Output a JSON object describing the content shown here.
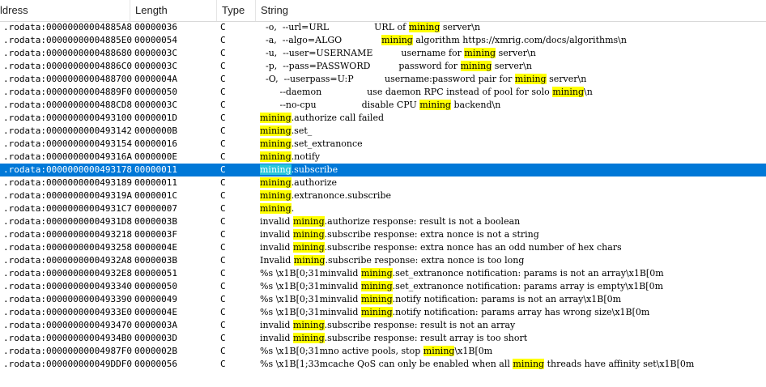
{
  "columns": {
    "address": "ldress",
    "length": "Length",
    "type": "Type",
    "string": "String"
  },
  "highlight_term": "mining",
  "selected_index": 11,
  "rows": [
    {
      "address": ".rodata:00000000004885A8",
      "length": "00000036",
      "type": "C",
      "string": "  -o,  --url=URL                URL of mining server\\n"
    },
    {
      "address": ".rodata:00000000004885E0",
      "length": "00000054",
      "type": "C",
      "string": "  -a,  --algo=ALGO              mining algorithm https://xmrig.com/docs/algorithms\\n"
    },
    {
      "address": ".rodata:0000000000488680",
      "length": "0000003C",
      "type": "C",
      "string": "  -u,  --user=USERNAME          username for mining server\\n"
    },
    {
      "address": ".rodata:00000000004886C0",
      "length": "0000003C",
      "type": "C",
      "string": "  -p,  --pass=PASSWORD          password for mining server\\n"
    },
    {
      "address": ".rodata:0000000000488700",
      "length": "0000004A",
      "type": "C",
      "string": "  -O,  --userpass=U:P           username:password pair for mining server\\n"
    },
    {
      "address": ".rodata:00000000004889F0",
      "length": "00000050",
      "type": "C",
      "string": "       --daemon                use daemon RPC instead of pool for solo mining\\n"
    },
    {
      "address": ".rodata:0000000000488CD8",
      "length": "0000003C",
      "type": "C",
      "string": "       --no-cpu                disable CPU mining backend\\n"
    },
    {
      "address": ".rodata:0000000000493100",
      "length": "0000001D",
      "type": "C",
      "string": "mining.authorize call failed"
    },
    {
      "address": ".rodata:0000000000493142",
      "length": "0000000B",
      "type": "C",
      "string": "mining.set_"
    },
    {
      "address": ".rodata:0000000000493154",
      "length": "00000016",
      "type": "C",
      "string": "mining.set_extranonce"
    },
    {
      "address": ".rodata:000000000049316A",
      "length": "0000000E",
      "type": "C",
      "string": "mining.notify"
    },
    {
      "address": ".rodata:0000000000493178",
      "length": "00000011",
      "type": "C",
      "string": "mining.subscribe"
    },
    {
      "address": ".rodata:0000000000493189",
      "length": "00000011",
      "type": "C",
      "string": "mining.authorize"
    },
    {
      "address": ".rodata:000000000049319A",
      "length": "0000001C",
      "type": "C",
      "string": "mining.extranonce.subscribe"
    },
    {
      "address": ".rodata:00000000004931C7",
      "length": "00000007",
      "type": "C",
      "string": "mining."
    },
    {
      "address": ".rodata:00000000004931D8",
      "length": "0000003B",
      "type": "C",
      "string": "invalid mining.authorize response: result is not a boolean"
    },
    {
      "address": ".rodata:0000000000493218",
      "length": "0000003F",
      "type": "C",
      "string": "invalid mining.subscribe response: extra nonce is not a string"
    },
    {
      "address": ".rodata:0000000000493258",
      "length": "0000004E",
      "type": "C",
      "string": "invalid mining.subscribe response: extra nonce has an odd number of hex chars"
    },
    {
      "address": ".rodata:00000000004932A8",
      "length": "0000003B",
      "type": "C",
      "string": "Invalid mining.subscribe response: extra nonce is too long"
    },
    {
      "address": ".rodata:00000000004932E8",
      "length": "00000051",
      "type": "C",
      "string": "%s \\x1B[0;31minvalid mining.set_extranonce notification: params is not an array\\x1B[0m"
    },
    {
      "address": ".rodata:0000000000493340",
      "length": "00000050",
      "type": "C",
      "string": "%s \\x1B[0;31minvalid mining.set_extranonce notification: params array is empty\\x1B[0m"
    },
    {
      "address": ".rodata:0000000000493390",
      "length": "00000049",
      "type": "C",
      "string": "%s \\x1B[0;31minvalid mining.notify notification: params is not an array\\x1B[0m"
    },
    {
      "address": ".rodata:00000000004933E0",
      "length": "0000004E",
      "type": "C",
      "string": "%s \\x1B[0;31minvalid mining.notify notification: params array has wrong size\\x1B[0m"
    },
    {
      "address": ".rodata:0000000000493470",
      "length": "0000003A",
      "type": "C",
      "string": "invalid mining.subscribe response: result is not an array"
    },
    {
      "address": ".rodata:00000000004934B0",
      "length": "0000003D",
      "type": "C",
      "string": "invalid mining.subscribe response: result array is too short"
    },
    {
      "address": ".rodata:00000000004987F0",
      "length": "0000002B",
      "type": "C",
      "string": "%s \\x1B[0;31mno active pools, stop mining\\x1B[0m"
    },
    {
      "address": ".rodata:000000000049DDF0",
      "length": "00000056",
      "type": "C",
      "string": "%s \\x1B[1;33mcache QoS can only be enabled when all mining threads have affinity set\\x1B[0m"
    }
  ]
}
